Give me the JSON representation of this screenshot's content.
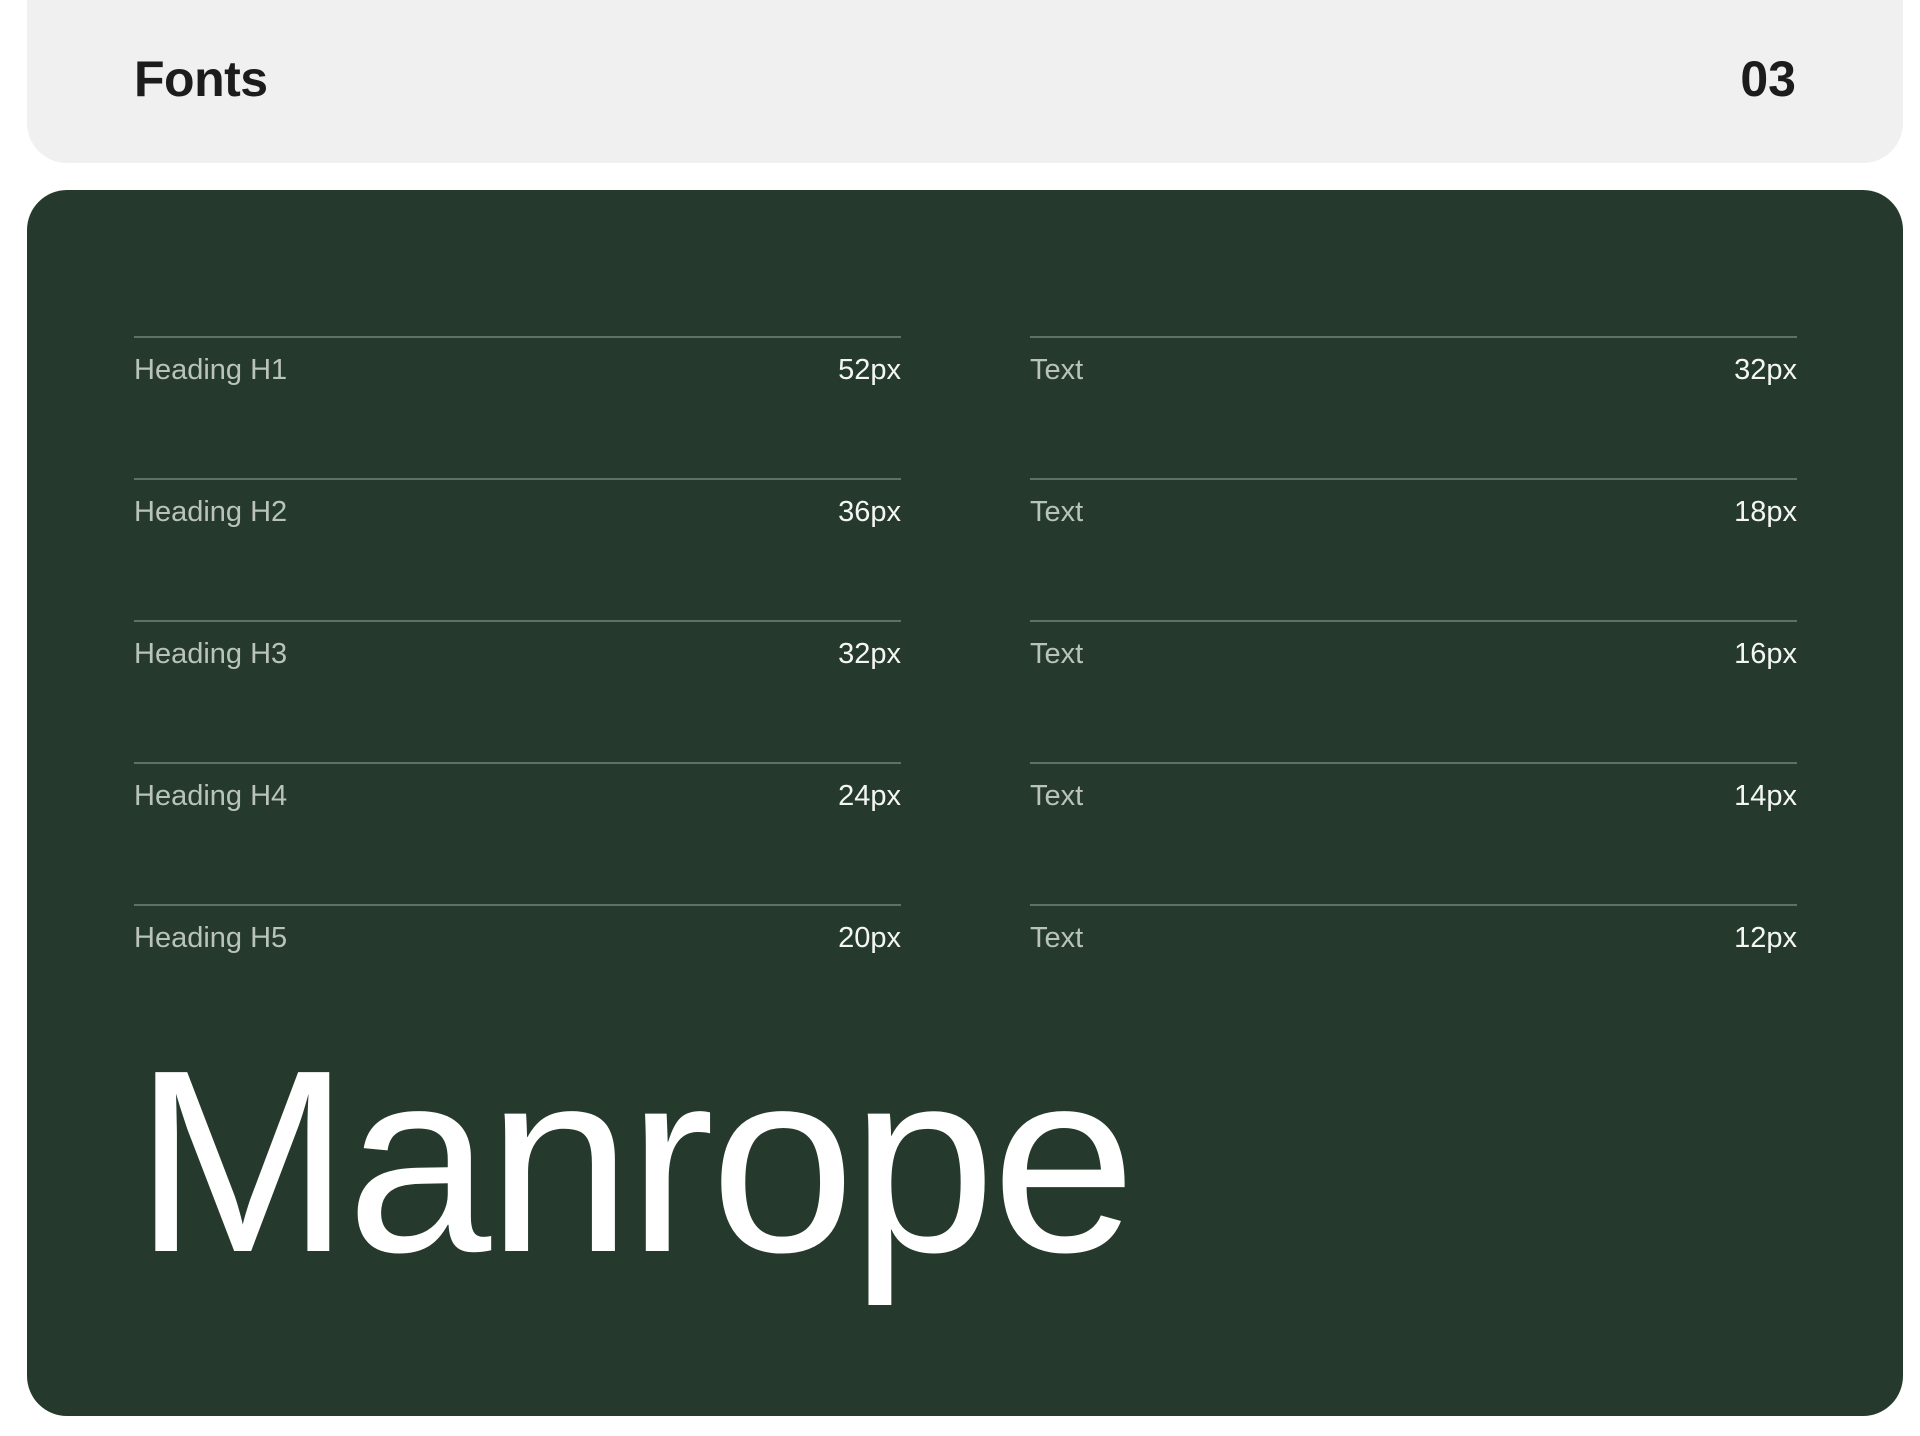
{
  "header": {
    "title": "Fonts",
    "number": "03"
  },
  "headings": [
    {
      "label": "Heading H1",
      "size": "52px"
    },
    {
      "label": "Heading H2",
      "size": "36px"
    },
    {
      "label": "Heading H3",
      "size": "32px"
    },
    {
      "label": "Heading H4",
      "size": "24px"
    },
    {
      "label": "Heading H5",
      "size": "20px"
    }
  ],
  "texts": [
    {
      "label": "Text",
      "size": "32px"
    },
    {
      "label": "Text",
      "size": "18px"
    },
    {
      "label": "Text",
      "size": "16px"
    },
    {
      "label": "Text",
      "size": "14px"
    },
    {
      "label": "Text",
      "size": "12px"
    }
  ],
  "font_name": "Manrope",
  "colors": {
    "header_bg": "#f0f0f1",
    "panel_bg": "#253a2c",
    "divider": "#5f7164",
    "text_light": "#ffffff"
  }
}
